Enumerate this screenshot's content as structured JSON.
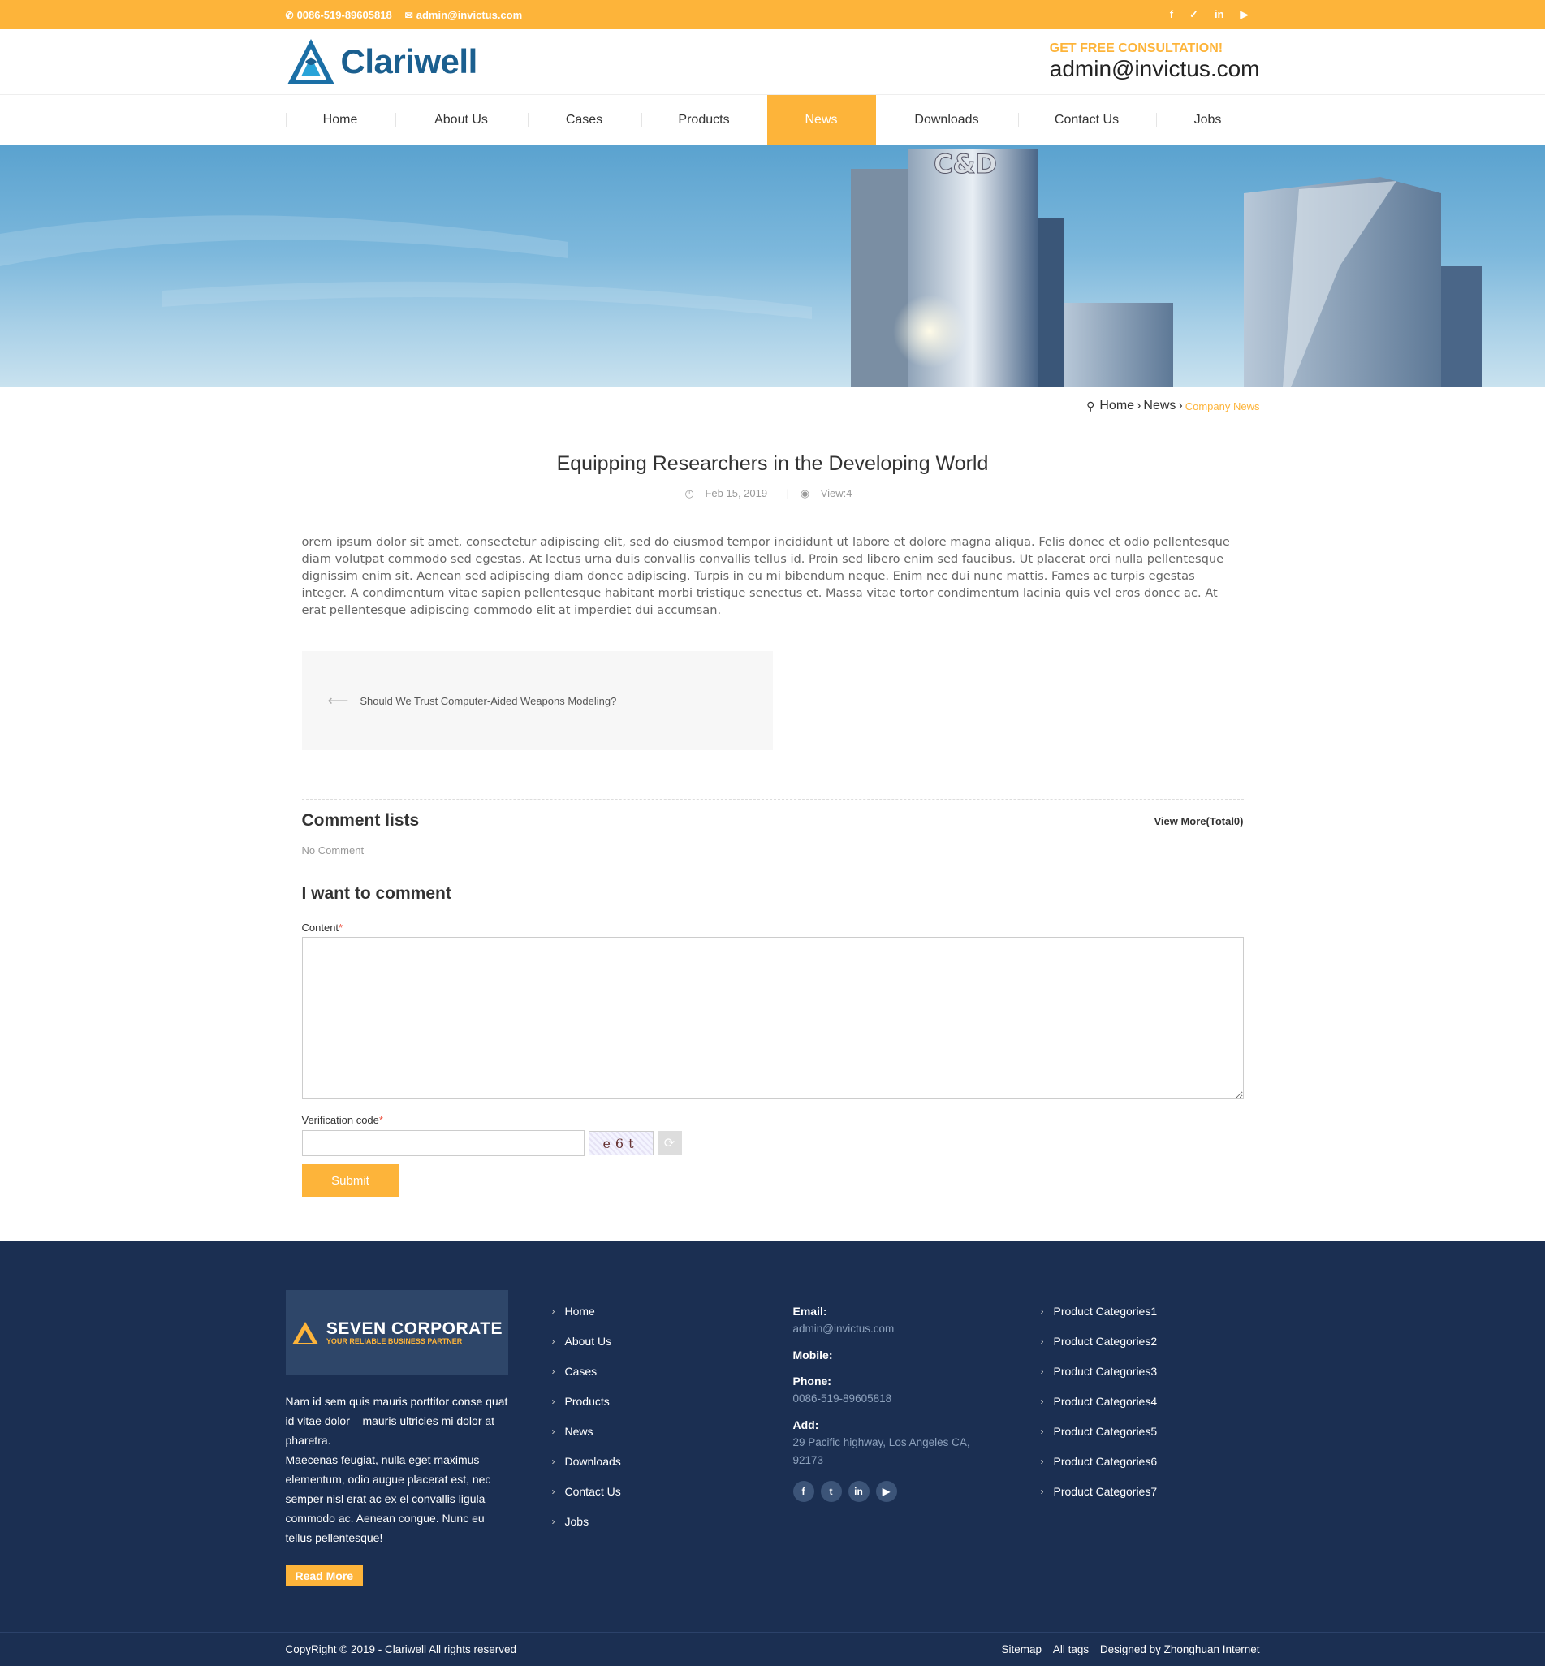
{
  "topbar": {
    "phone": "0086-519-89605818",
    "email": "admin@invictus.com",
    "social": [
      "f",
      "t",
      "in",
      "yt"
    ]
  },
  "header": {
    "brand": "Clariwell",
    "consult_label": "GET FREE CONSULTATION!",
    "consult_email": "admin@invictus.com"
  },
  "nav": {
    "items": [
      "Home",
      "About Us",
      "Cases",
      "Products",
      "News",
      "Downloads",
      "Contact Us",
      "Jobs"
    ],
    "active": "News"
  },
  "banner": {
    "sign": "C&D"
  },
  "breadcrumb": {
    "home": "Home",
    "section": "News",
    "current": "Company News"
  },
  "article": {
    "title": "Equipping Researchers in the Developing World",
    "date": "Feb 15, 2019",
    "views": "View:4",
    "body": "orem ipsum dolor sit amet, consectetur adipiscing elit, sed do eiusmod tempor incididunt ut labore et dolore magna aliqua. Felis donec et odio pellentesque diam volutpat commodo sed egestas. At lectus urna duis convallis convallis tellus id. Proin sed libero enim sed faucibus. Ut placerat orci nulla pellentesque dignissim enim sit. Aenean sed adipiscing diam donec adipiscing. Turpis in eu mi bibendum neque. Enim nec dui nunc mattis. Fames ac turpis egestas integer. A condimentum vitae sapien pellentesque habitant morbi tristique senectus et. Massa vitae tortor condimentum lacinia quis vel eros donec ac. At erat pellentesque adipiscing commodo elit at imperdiet dui accumsan.",
    "prev_title": "Should We Trust Computer-Aided Weapons Modeling?"
  },
  "comments": {
    "heading": "Comment lists",
    "view_more": "View More(Total0)",
    "empty": "No Comment",
    "form_heading": "I want to comment",
    "content_label": "Content",
    "verify_label": "Verification code",
    "captcha": "e6t",
    "submit": "Submit"
  },
  "footer": {
    "logo_big": "SEVEN CORPORATE",
    "logo_small": "YOUR RELIABLE BUSINESS PARTNER",
    "about_1": "Nam id sem quis mauris porttitor conse quat id vitae dolor – mauris ultricies mi dolor at pharetra.",
    "about_2": "Maecenas feugiat, nulla eget maximus elementum, odio augue placerat est, nec semper nisl erat ac ex el convallis ligula commodo ac. Aenean congue. Nunc eu tellus pellentesque!",
    "read_more": "Read More",
    "links": [
      "Home",
      "About Us",
      "Cases",
      "Products",
      "News",
      "Downloads",
      "Contact Us",
      "Jobs"
    ],
    "email_label": "Email:",
    "email": "admin@invictus.com",
    "mobile_label": "Mobile:",
    "phone_label": "Phone:",
    "phone": "0086-519-89605818",
    "add_label": "Add:",
    "address": "29 Pacific highway, Los Angeles CA, 92173",
    "categories": [
      "Product Categories1",
      "Product Categories2",
      "Product Categories3",
      "Product Categories4",
      "Product Categories5",
      "Product Categories6",
      "Product Categories7"
    ],
    "copyright": "CopyRight © 2019 -   Clariwell  All rights reserved",
    "sitemap": "Sitemap",
    "alltags": "All tags",
    "designed": "Designed by Zhonghuan Internet"
  },
  "colors": {
    "accent": "#fdb43a",
    "footer": "#1b2f52",
    "brand": "#1b5f8f"
  }
}
